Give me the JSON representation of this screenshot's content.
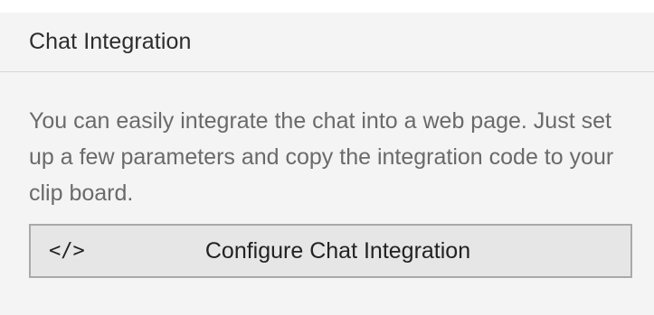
{
  "panel": {
    "title": "Chat Integration",
    "description": "You can easily integrate the chat into a web page. Just set up a few parameters and copy the integration code to your clip board.",
    "button": {
      "icon": "code-icon",
      "icon_glyph": "</>",
      "label": "Configure Chat Integration"
    }
  }
}
